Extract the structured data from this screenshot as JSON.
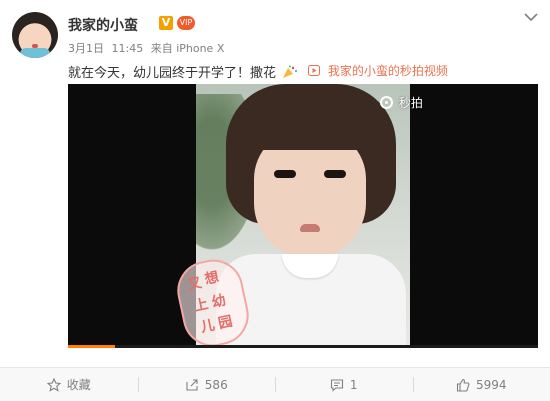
{
  "user": {
    "name": "我家的小蛮",
    "verified_badge": "V",
    "vip_badge": "VIP"
  },
  "meta": {
    "date": "3月1日",
    "time": "11:45",
    "source": "来自 iPhone X"
  },
  "post": {
    "text": "就在今天，幼儿园终于开学了！撒花",
    "link": "我家的小蛮的秒拍视频"
  },
  "video": {
    "watermark": "秒拍",
    "sticker": [
      "又",
      "想",
      "上",
      "幼",
      "儿",
      "园"
    ],
    "progress": 0.1
  },
  "actions": {
    "favorite": "收藏",
    "repost": "586",
    "comment": "1",
    "like": "5994"
  },
  "colors": {
    "link": "#eb7350",
    "progress": "#ff8200",
    "muted": "#808080"
  },
  "icons": [
    "star-icon",
    "repost-icon",
    "comment-icon",
    "like-icon",
    "chevron-down-icon",
    "party-icon",
    "play-icon"
  ]
}
